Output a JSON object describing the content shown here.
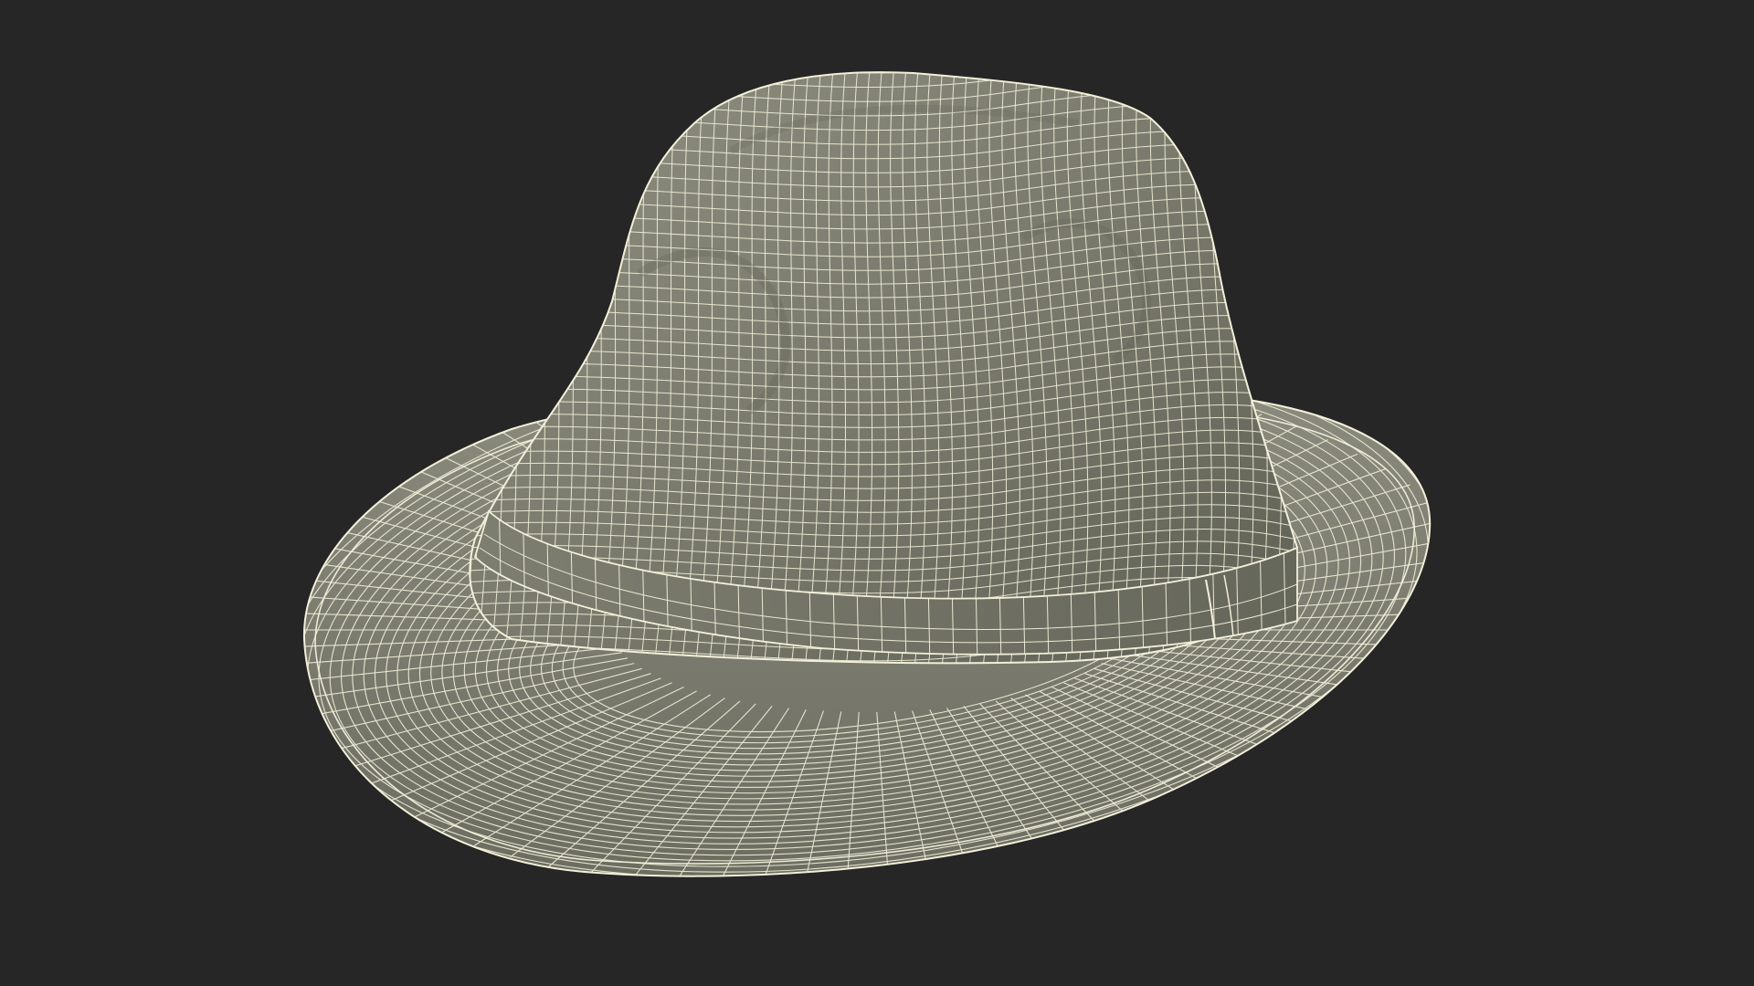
{
  "scene": {
    "subject": "fedora-hat-wireframe",
    "background_color": "#262626",
    "surface_color": "#77786a",
    "surface_shadow_color": "#5f6055",
    "surface_highlight_color": "#8e8f81",
    "wire_color": "#f2f0da"
  }
}
